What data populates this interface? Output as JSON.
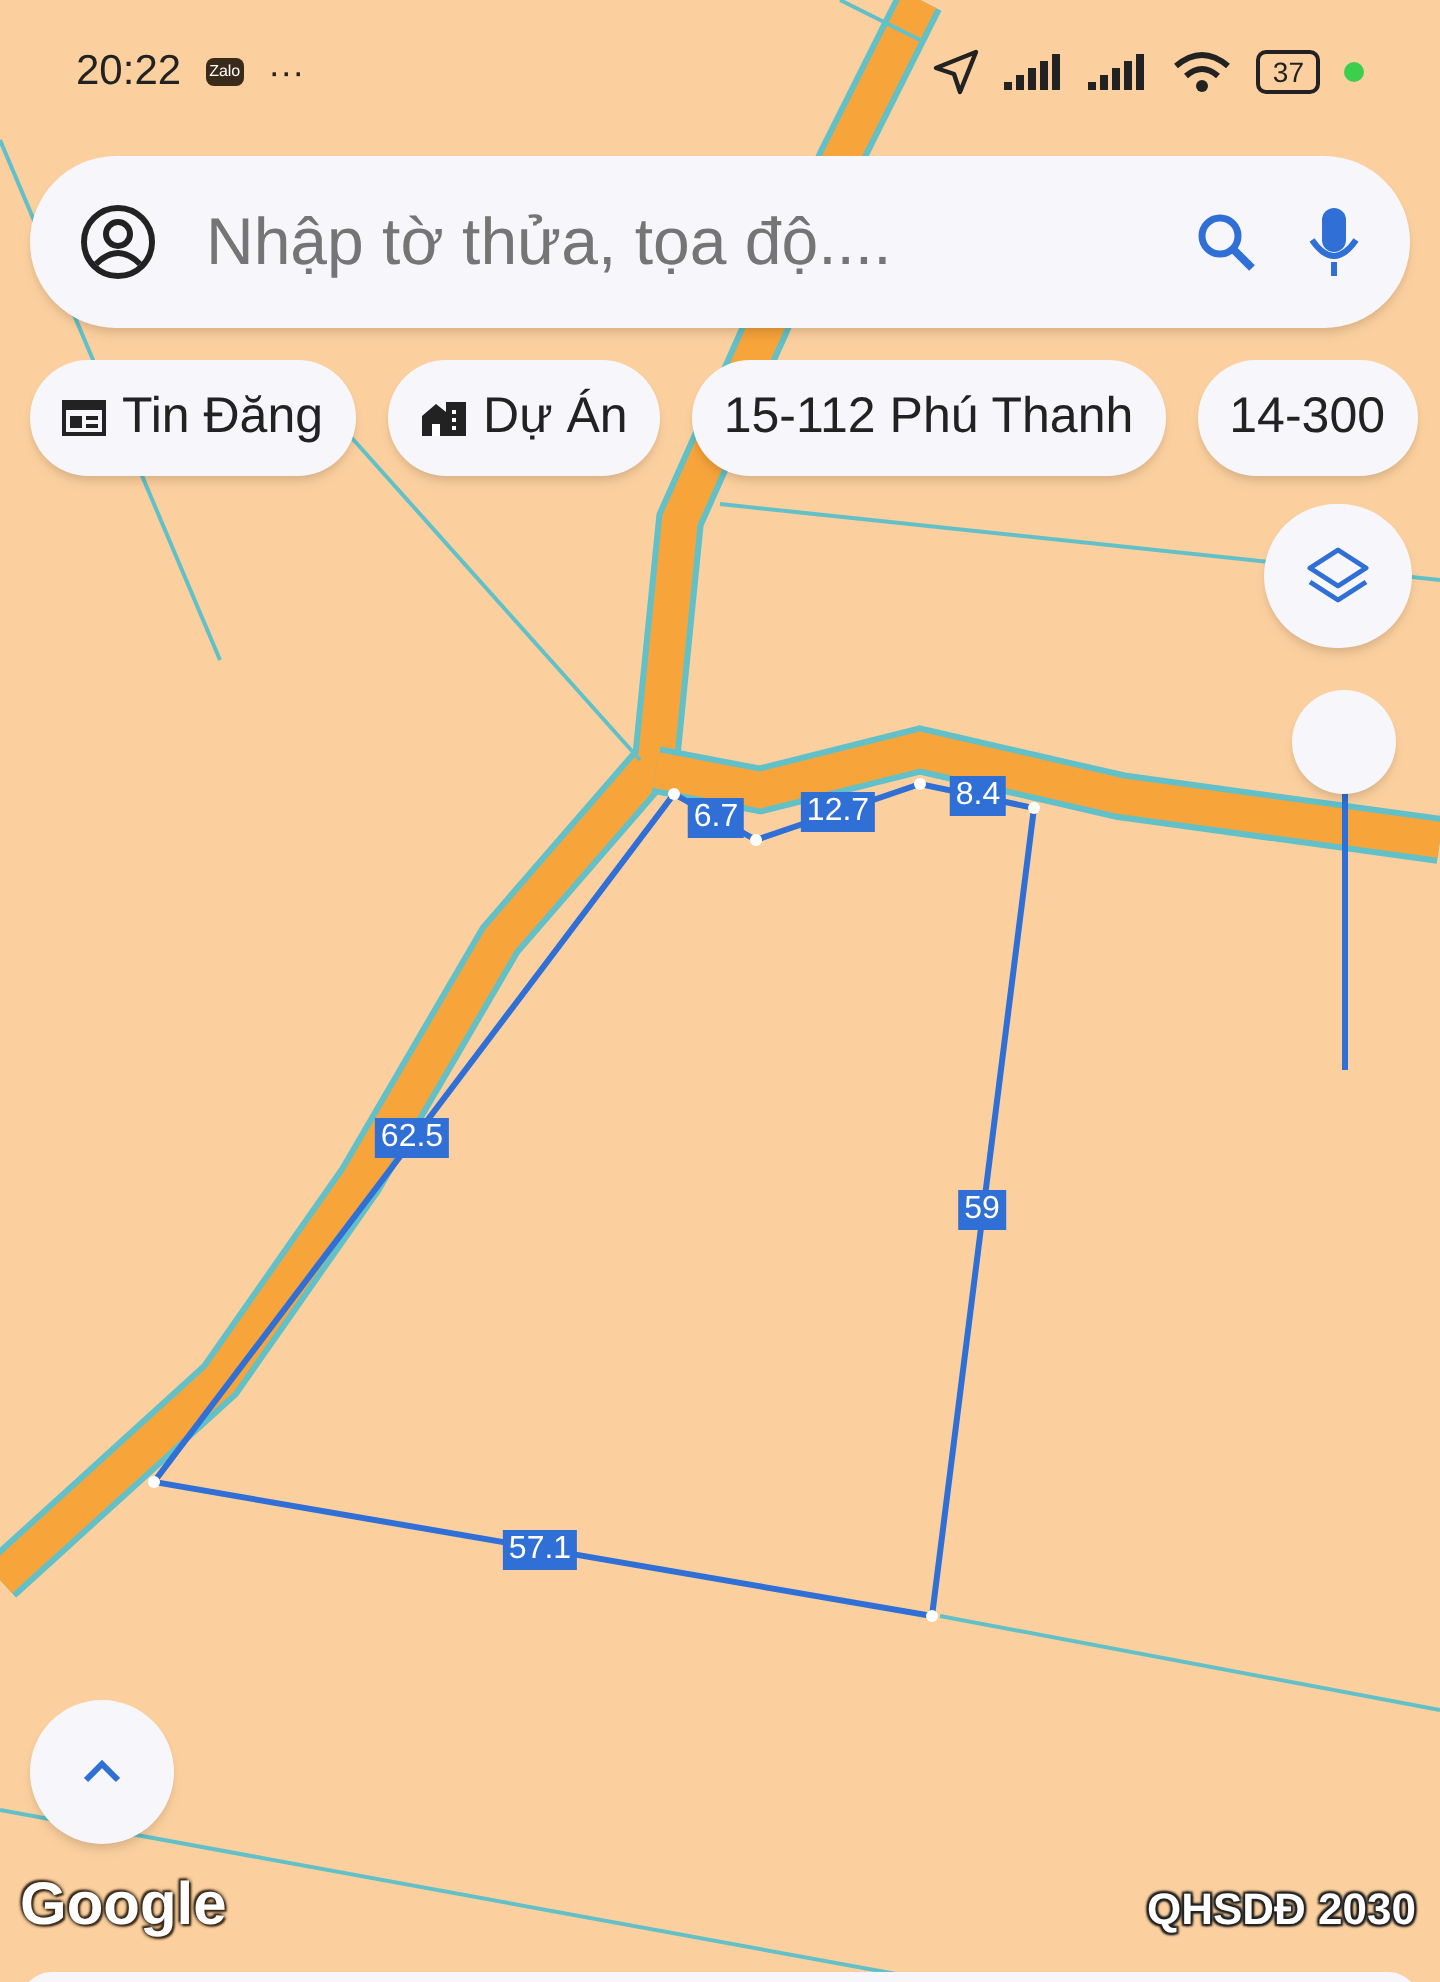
{
  "status_bar": {
    "time": "20:22",
    "app_badge": "Zalo",
    "more": "···",
    "battery": "37",
    "charging_dot": true
  },
  "search": {
    "placeholder": "Nhập tờ thửa, tọa độ...."
  },
  "chips": [
    {
      "kind": "news",
      "label": "Tin Đăng"
    },
    {
      "kind": "project",
      "label": "Dự Án"
    },
    {
      "kind": "place",
      "label": "15-112 Phú Thanh"
    },
    {
      "kind": "place",
      "label": "14-300"
    }
  ],
  "zoom_slider": {
    "level": 1
  },
  "parcel": {
    "edges": [
      {
        "label": "6.7"
      },
      {
        "label": "12.7"
      },
      {
        "label": "8.4"
      },
      {
        "label": "59"
      },
      {
        "label": "57.1"
      },
      {
        "label": "62.5"
      }
    ]
  },
  "map_overlay": {
    "attribution": "Google",
    "layer_name": "QHSDĐ 2030"
  }
}
